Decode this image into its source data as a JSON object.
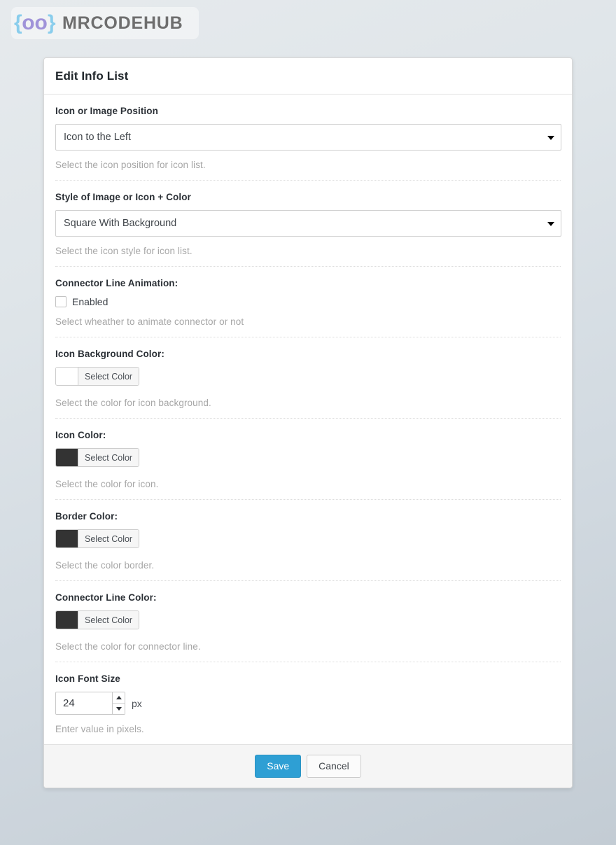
{
  "brand": {
    "mark_open": "{",
    "mark_oo": "oo",
    "mark_close": "}",
    "word": "MRCODEHUB",
    "brace_color": "#89cdec",
    "oo_color": "#a093d9",
    "word_color": "#6e6e6e"
  },
  "card": {
    "title": "Edit Info List"
  },
  "fields": [
    {
      "label": "Icon or Image Position",
      "control": "select",
      "value": "Icon to the Left",
      "help": "Select the icon position for icon list."
    },
    {
      "label": "Style of Image or Icon + Color",
      "control": "select",
      "value": "Square With Background",
      "help": "Select the icon style for icon list."
    },
    {
      "label": "Connector Line Animation:",
      "control": "checkbox",
      "checkbox_label": "Enabled",
      "checked": false,
      "help": "Select wheather to animate connector or not"
    },
    {
      "label": "Icon Background Color:",
      "control": "color",
      "button_label": "Select Color",
      "swatch": "#ffffff",
      "help": "Select the color for icon background."
    },
    {
      "label": "Icon Color:",
      "control": "color",
      "button_label": "Select Color",
      "swatch": "#333333",
      "help": "Select the color for icon."
    },
    {
      "label": "Border Color:",
      "control": "color",
      "button_label": "Select Color",
      "swatch": "#333333",
      "help": "Select the color border."
    },
    {
      "label": "Connector Line Color:",
      "control": "color",
      "button_label": "Select Color",
      "swatch": "#333333",
      "help": "Select the color for connector line."
    },
    {
      "label": "Icon Font Size",
      "control": "number",
      "value": "24",
      "unit": "px",
      "help": "Enter value in pixels."
    }
  ],
  "footer": {
    "save_label": "Save",
    "cancel_label": "Cancel",
    "save_color": "#2e9fd4"
  }
}
